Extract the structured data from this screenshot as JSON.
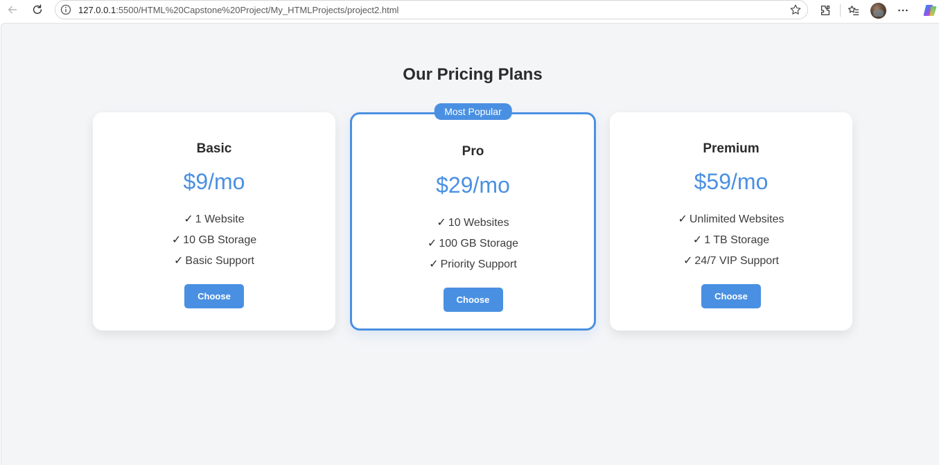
{
  "browser": {
    "url_host": "127.0.0.1",
    "url_rest": ":5500/HTML%20Capstone%20Project/My_HTMLProjects/project2.html"
  },
  "page": {
    "title": "Our Pricing Plans"
  },
  "plans": [
    {
      "name": "Basic",
      "price": "$9/mo",
      "features": [
        "1 Website",
        "10 GB Storage",
        "Basic Support"
      ],
      "button_label": "Choose",
      "highlighted": false
    },
    {
      "name": "Pro",
      "badge": "Most Popular",
      "price": "$29/mo",
      "features": [
        "10 Websites",
        "100 GB Storage",
        "Priority Support"
      ],
      "button_label": "Choose",
      "highlighted": true
    },
    {
      "name": "Premium",
      "price": "$59/mo",
      "features": [
        "Unlimited Websites",
        "1 TB Storage",
        "24/7 VIP Support"
      ],
      "button_label": "Choose",
      "highlighted": false
    }
  ],
  "check_glyph": "✓",
  "colors": {
    "accent": "#4a90e2",
    "page_bg": "#f4f5f7",
    "card_bg": "#ffffff",
    "heading": "#2b2b2b"
  },
  "icons": [
    "back-icon",
    "reload-icon",
    "info-icon",
    "star-icon",
    "extensions-icon",
    "favorites-icon",
    "avatar",
    "more-icon",
    "copilot-icon"
  ]
}
